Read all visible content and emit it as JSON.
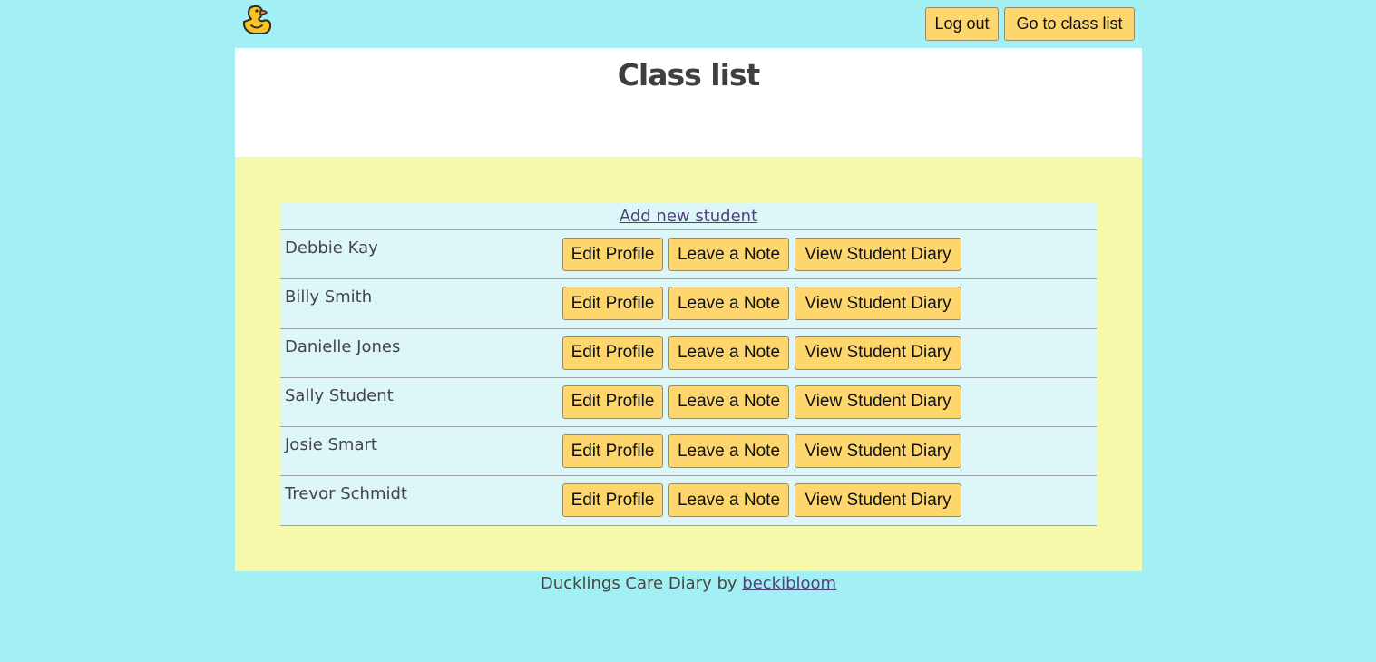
{
  "header": {
    "logo_icon": "rubber-duck-icon",
    "logout_label": "Log out",
    "class_list_label": "Go to class list"
  },
  "page": {
    "title": "Class list"
  },
  "table": {
    "add_student_label": "Add new student",
    "students": [
      {
        "name": "Debbie Kay",
        "edit_label": "Edit Profile",
        "note_label": "Leave a Note",
        "diary_label": "View Student Diary"
      },
      {
        "name": "Billy Smith",
        "edit_label": "Edit Profile",
        "note_label": "Leave a Note",
        "diary_label": "View Student Diary"
      },
      {
        "name": "Danielle Jones",
        "edit_label": "Edit Profile",
        "note_label": "Leave a Note",
        "diary_label": "View Student Diary"
      },
      {
        "name": "Sally Student",
        "edit_label": "Edit Profile",
        "note_label": "Leave a Note",
        "diary_label": "View Student Diary"
      },
      {
        "name": "Josie Smart",
        "edit_label": "Edit Profile",
        "note_label": "Leave a Note",
        "diary_label": "View Student Diary"
      },
      {
        "name": "Trevor Schmidt",
        "edit_label": "Edit Profile",
        "note_label": "Leave a Note",
        "diary_label": "View Student Diary"
      }
    ]
  },
  "footer": {
    "text": "Ducklings Care Diary by ",
    "link_text": "beckibloom"
  },
  "colors": {
    "background": "#a3f0f4",
    "panel_yellow": "#f6f8ab",
    "table_bg": "#ddf7f8",
    "button": "#fdd66e",
    "link": "#52407d"
  }
}
